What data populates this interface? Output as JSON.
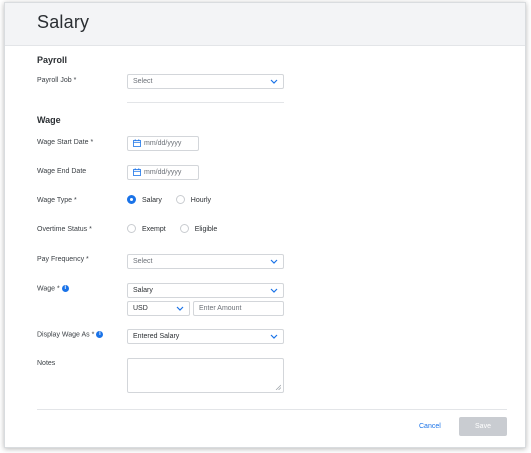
{
  "title": "Salary",
  "payroll": {
    "section_title": "Payroll",
    "job_label": "Payroll Job",
    "job_placeholder": "Select"
  },
  "wage": {
    "section_title": "Wage",
    "start_date_label": "Wage Start Date",
    "start_date_placeholder": "mm/dd/yyyy",
    "end_date_label": "Wage End Date",
    "end_date_placeholder": "mm/dd/yyyy",
    "type_label": "Wage Type",
    "type_options": [
      "Salary",
      "Hourly"
    ],
    "type_selected": "Salary",
    "overtime_label": "Overtime Status",
    "overtime_options": [
      "Exempt",
      "Eligible"
    ],
    "pay_frequency_label": "Pay Frequency",
    "pay_frequency_placeholder": "Select",
    "wage_label": "Wage",
    "wage_kind_value": "Salary",
    "currency_value": "USD",
    "amount_placeholder": "Enter Amount",
    "display_as_label": "Display Wage As",
    "display_as_value": "Entered Salary",
    "notes_label": "Notes"
  },
  "required_marker": "*",
  "info_glyph": "i",
  "footer": {
    "cancel_label": "Cancel",
    "save_label": "Save"
  },
  "colors": {
    "accent": "#1a73e8",
    "save_disabled": "#c9ccd1",
    "header_bg": "#f3f4f6"
  }
}
